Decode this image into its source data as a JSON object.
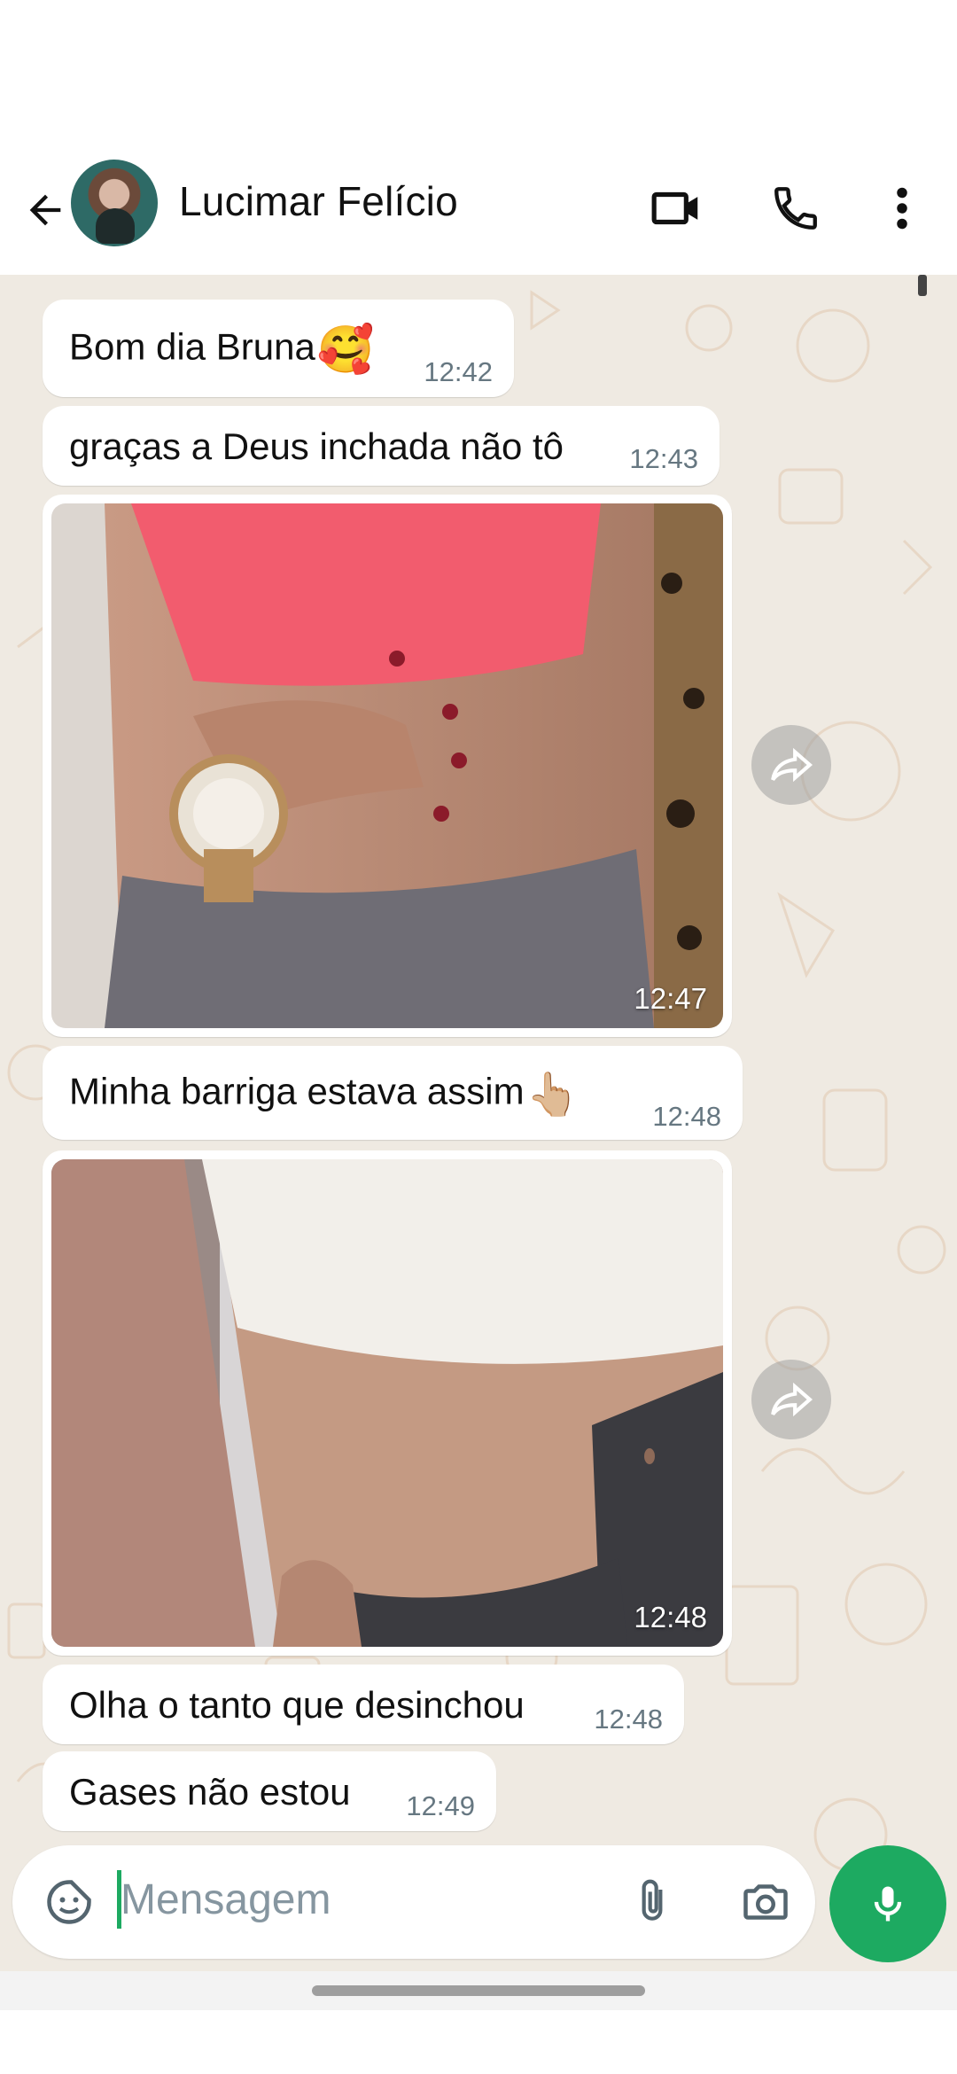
{
  "header": {
    "contact_name": "Lucimar Felício",
    "back_icon": "arrow-left-icon",
    "video_icon": "video-call-icon",
    "call_icon": "phone-icon",
    "menu_icon": "more-vertical-icon"
  },
  "messages": [
    {
      "type": "text",
      "text": "Bom dia Bruna",
      "emoji": "🥰",
      "time": "12:42"
    },
    {
      "type": "text",
      "text": "graças a Deus inchada não tô",
      "time": "12:43"
    },
    {
      "type": "image",
      "time": "12:47"
    },
    {
      "type": "text",
      "text": "Minha barriga estava assim",
      "emoji": "👆🏼",
      "time": "12:48"
    },
    {
      "type": "image",
      "time": "12:48"
    },
    {
      "type": "text",
      "text": "Olha o tanto que desinchou",
      "time": "12:48"
    },
    {
      "type": "text",
      "text": "Gases não estou",
      "time": "12:49"
    }
  ],
  "composer": {
    "placeholder": "Mensagem",
    "sticker_icon": "sticker-icon",
    "attach_icon": "paperclip-icon",
    "camera_icon": "camera-icon",
    "mic_icon": "microphone-icon"
  },
  "colors": {
    "accent": "#1daa61",
    "chat_background": "#efeae2",
    "bubble": "#ffffff",
    "timestamp": "#667781"
  }
}
